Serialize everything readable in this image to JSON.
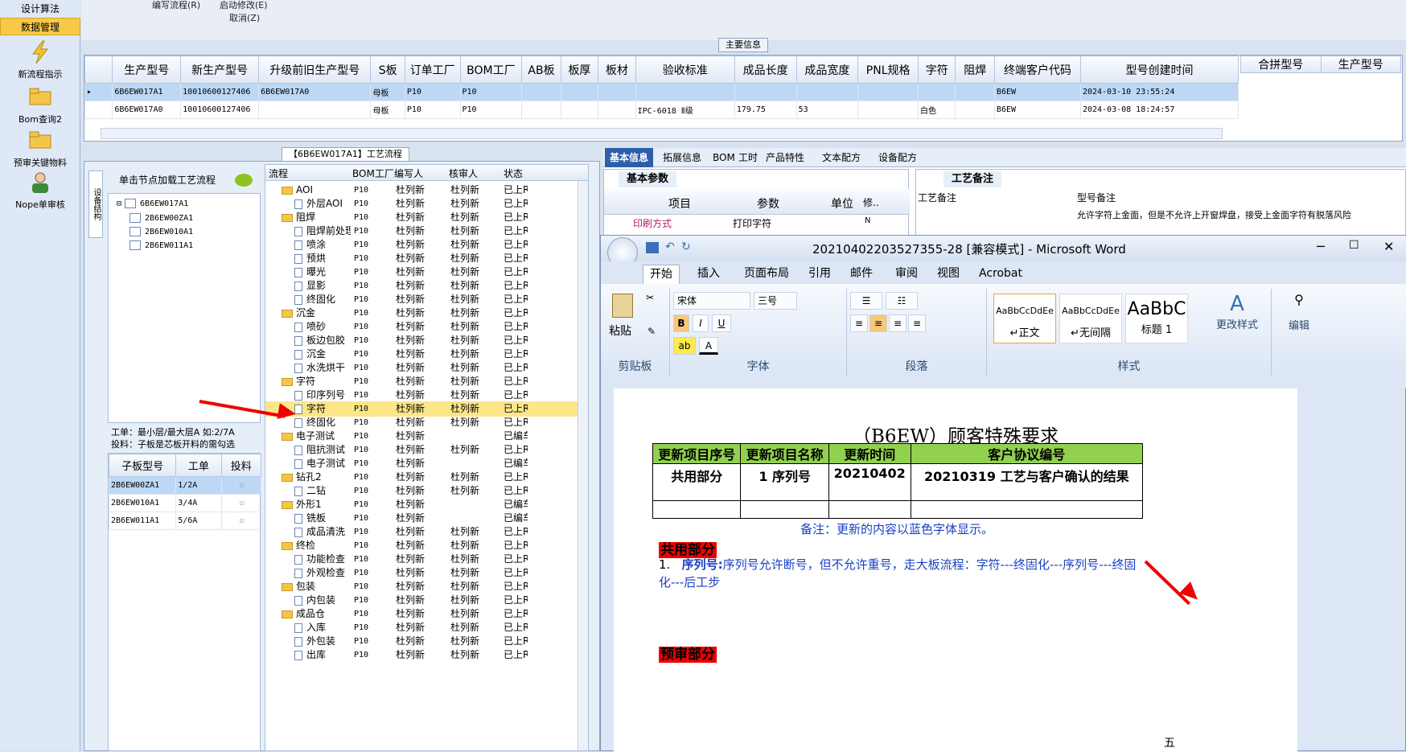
{
  "leftnav": {
    "items": [
      {
        "label": "设计算法"
      },
      {
        "label": "数据管理"
      },
      {
        "label": "新流程指示"
      },
      {
        "label": "Bom查询2"
      },
      {
        "label": "预审关键物料"
      },
      {
        "label": "Nope单审核"
      }
    ]
  },
  "toolbar": {
    "items": [
      "编写流程(R)",
      "启动修改(E)",
      "取消(Z)"
    ]
  },
  "main_info": {
    "title": "主要信息",
    "columns": [
      "生产型号",
      "新生产型号",
      "升级前旧生产型号",
      "S板",
      "订单工厂",
      "BOM工厂",
      "AB板",
      "板厚",
      "板材",
      "验收标准",
      "成品长度",
      "成品宽度",
      "PNL规格",
      "字符",
      "阻焊",
      "终端客户代码",
      "型号创建时间"
    ],
    "rows": [
      [
        "6B6EW017A1",
        "10010600127406",
        "6B6EW017A0",
        "母板",
        "P10",
        "P10",
        "",
        "",
        "",
        "",
        "",
        "",
        "",
        "",
        "",
        "B6EW",
        "2024-03-10 23:55:24"
      ],
      [
        "6B6EW017A0",
        "10010600127406",
        "",
        "母板",
        "P10",
        "P10",
        "",
        "",
        "",
        "IPC-6018 Ⅱ级",
        "179.75",
        "53",
        "",
        "白色",
        "",
        "B6EW",
        "2024-03-08 18:24:57"
      ]
    ],
    "merge_columns": [
      "合拼型号",
      "生产型号"
    ]
  },
  "flow_panel": {
    "title": "【6B6EW017A1】工艺流程",
    "vertical_tab": "设备结构",
    "tree_hint": "单击节点加载工艺流程",
    "tree_root": "6B6EW017A1",
    "tree_children": [
      "2B6EW00ZA1",
      "2B6EW010A1",
      "2B6EW011A1"
    ],
    "info_line1": "工单：最小层/最大层A 如:2/7A",
    "info_line2": "投料：子板是芯板开料的需勾选",
    "sub_columns": [
      "子板型号",
      "工单",
      "投料"
    ],
    "sub_rows": [
      [
        "2B6EW00ZA1",
        "1/2A"
      ],
      [
        "2B6EW010A1",
        "3/4A"
      ],
      [
        "2B6EW011A1",
        "5/6A"
      ]
    ],
    "flow_columns": [
      "流程",
      "BOM工厂",
      "编写人",
      "核审人",
      "状态"
    ],
    "flow_rows": [
      {
        "name": "AOI",
        "folder": true,
        "f": "P10",
        "w": "杜列新",
        "r": "杜列新",
        "s": "已上R"
      },
      {
        "name": "外层AOI",
        "folder": false,
        "f": "P10",
        "w": "杜列新",
        "r": "杜列新",
        "s": "已上R"
      },
      {
        "name": "阻焊",
        "folder": true,
        "f": "P10",
        "w": "杜列新",
        "r": "杜列新",
        "s": "已上R"
      },
      {
        "name": "阻焊前处理",
        "folder": false,
        "f": "P10",
        "w": "杜列新",
        "r": "杜列新",
        "s": "已上R"
      },
      {
        "name": "喷涂",
        "folder": false,
        "f": "P10",
        "w": "杜列新",
        "r": "杜列新",
        "s": "已上R"
      },
      {
        "name": "预烘",
        "folder": false,
        "f": "P10",
        "w": "杜列新",
        "r": "杜列新",
        "s": "已上R"
      },
      {
        "name": "曝光",
        "folder": false,
        "f": "P10",
        "w": "杜列新",
        "r": "杜列新",
        "s": "已上R"
      },
      {
        "name": "显影",
        "folder": false,
        "f": "P10",
        "w": "杜列新",
        "r": "杜列新",
        "s": "已上R"
      },
      {
        "name": "终固化",
        "folder": false,
        "f": "P10",
        "w": "杜列新",
        "r": "杜列新",
        "s": "已上R"
      },
      {
        "name": "沉金",
        "folder": true,
        "f": "P10",
        "w": "杜列新",
        "r": "杜列新",
        "s": "已上R"
      },
      {
        "name": "喷砂",
        "folder": false,
        "f": "P10",
        "w": "杜列新",
        "r": "杜列新",
        "s": "已上R"
      },
      {
        "name": "板边包胶",
        "folder": false,
        "f": "P10",
        "w": "杜列新",
        "r": "杜列新",
        "s": "已上R"
      },
      {
        "name": "沉金",
        "folder": false,
        "f": "P10",
        "w": "杜列新",
        "r": "杜列新",
        "s": "已上R"
      },
      {
        "name": "水洗烘干",
        "folder": false,
        "f": "P10",
        "w": "杜列新",
        "r": "杜列新",
        "s": "已上R"
      },
      {
        "name": "字符",
        "folder": true,
        "f": "P10",
        "w": "杜列新",
        "r": "杜列新",
        "s": "已上R"
      },
      {
        "name": "印序列号",
        "folder": false,
        "f": "P10",
        "w": "杜列新",
        "r": "杜列新",
        "s": "已上R"
      },
      {
        "name": "字符",
        "folder": false,
        "f": "P10",
        "w": "杜列新",
        "r": "杜列新",
        "s": "已上R",
        "sel": true
      },
      {
        "name": "终固化",
        "folder": false,
        "f": "P10",
        "w": "杜列新",
        "r": "杜列新",
        "s": "已上R"
      },
      {
        "name": "电子测试",
        "folder": true,
        "f": "P10",
        "w": "杜列新",
        "r": "",
        "s": "已编车"
      },
      {
        "name": "阻抗测试",
        "folder": false,
        "f": "P10",
        "w": "杜列新",
        "r": "杜列新",
        "s": "已上R"
      },
      {
        "name": "电子测试",
        "folder": false,
        "f": "P10",
        "w": "杜列新",
        "r": "",
        "s": "已编车"
      },
      {
        "name": "钻孔2",
        "folder": true,
        "f": "P10",
        "w": "杜列新",
        "r": "杜列新",
        "s": "已上R"
      },
      {
        "name": "二钻",
        "folder": false,
        "f": "P10",
        "w": "杜列新",
        "r": "杜列新",
        "s": "已上R"
      },
      {
        "name": "外形1",
        "folder": true,
        "f": "P10",
        "w": "杜列新",
        "r": "",
        "s": "已编车"
      },
      {
        "name": "铣板",
        "folder": false,
        "f": "P10",
        "w": "杜列新",
        "r": "",
        "s": "已编车"
      },
      {
        "name": "成品清洗",
        "folder": false,
        "f": "P10",
        "w": "杜列新",
        "r": "杜列新",
        "s": "已上R"
      },
      {
        "name": "终检",
        "folder": true,
        "f": "P10",
        "w": "杜列新",
        "r": "杜列新",
        "s": "已上R"
      },
      {
        "name": "功能检查",
        "folder": false,
        "f": "P10",
        "w": "杜列新",
        "r": "杜列新",
        "s": "已上R"
      },
      {
        "name": "外观检查",
        "folder": false,
        "f": "P10",
        "w": "杜列新",
        "r": "杜列新",
        "s": "已上R"
      },
      {
        "name": "包装",
        "folder": true,
        "f": "P10",
        "w": "杜列新",
        "r": "杜列新",
        "s": "已上R"
      },
      {
        "name": "内包装",
        "folder": false,
        "f": "P10",
        "w": "杜列新",
        "r": "杜列新",
        "s": "已上R"
      },
      {
        "name": "成品仓",
        "folder": true,
        "f": "P10",
        "w": "杜列新",
        "r": "杜列新",
        "s": "已上R"
      },
      {
        "name": "入库",
        "folder": false,
        "f": "P10",
        "w": "杜列新",
        "r": "杜列新",
        "s": "已上R"
      },
      {
        "name": "外包装",
        "folder": false,
        "f": "P10",
        "w": "杜列新",
        "r": "杜列新",
        "s": "已上R"
      },
      {
        "name": "出库",
        "folder": false,
        "f": "P10",
        "w": "杜列新",
        "r": "杜列新",
        "s": "已上R"
      }
    ]
  },
  "right_panel": {
    "tabs": [
      "基本信息",
      "拓展信息",
      "BOM",
      "工时",
      "产品特性",
      "文本配方",
      "设备配方"
    ],
    "basic_params_title": "基本参数",
    "param_columns": [
      "项目",
      "参数",
      "单位",
      "修.."
    ],
    "param_row": [
      "印刷方式",
      "打印字符",
      "",
      "N"
    ],
    "craft_note_title": "工艺备注",
    "craft_columns": [
      "工艺备注",
      "型号备注"
    ],
    "craft_text": "允许字符上金面，但是不允许上开窗焊盘，接受上金面字符有脱落风险"
  },
  "word": {
    "title": "20210402203527355-28 [兼容模式] - Microsoft Word",
    "tabs": [
      "开始",
      "插入",
      "页面布局",
      "引用",
      "邮件",
      "审阅",
      "视图",
      "Acrobat"
    ],
    "font_name": "宋体",
    "font_size": "三号",
    "groups": [
      "剪贴板",
      "字体",
      "段落",
      "样式"
    ],
    "paste": "粘贴",
    "styles": [
      {
        "preview": "AaBbCcDdEe",
        "name": "↵正文"
      },
      {
        "preview": "AaBbCcDdEe",
        "name": "↵无间隔"
      },
      {
        "preview": "AaBbC",
        "name": "标题 1"
      }
    ],
    "change_styles": "更改样式",
    "edit": "编辑",
    "doc": {
      "heading": "（B6EW）顾客特殊要求",
      "table_headers": [
        "更新项目序号",
        "更新项目名称",
        "更新时间",
        "客户协议编号"
      ],
      "table_row": [
        "共用部分",
        "1 序列号",
        "20210402",
        "20210319 工艺与客户确认的结果"
      ],
      "note": "备注：更新的内容以蓝色字体显示。",
      "section1": "共用部分",
      "item1_label": "序列号:",
      "item1_text": "序列号允许断号，但不允许重号，走大板流程：字符---终固化---序列号---终固化---后工步",
      "section2": "预审部分"
    }
  },
  "taskbar": {
    "ime": "五"
  }
}
